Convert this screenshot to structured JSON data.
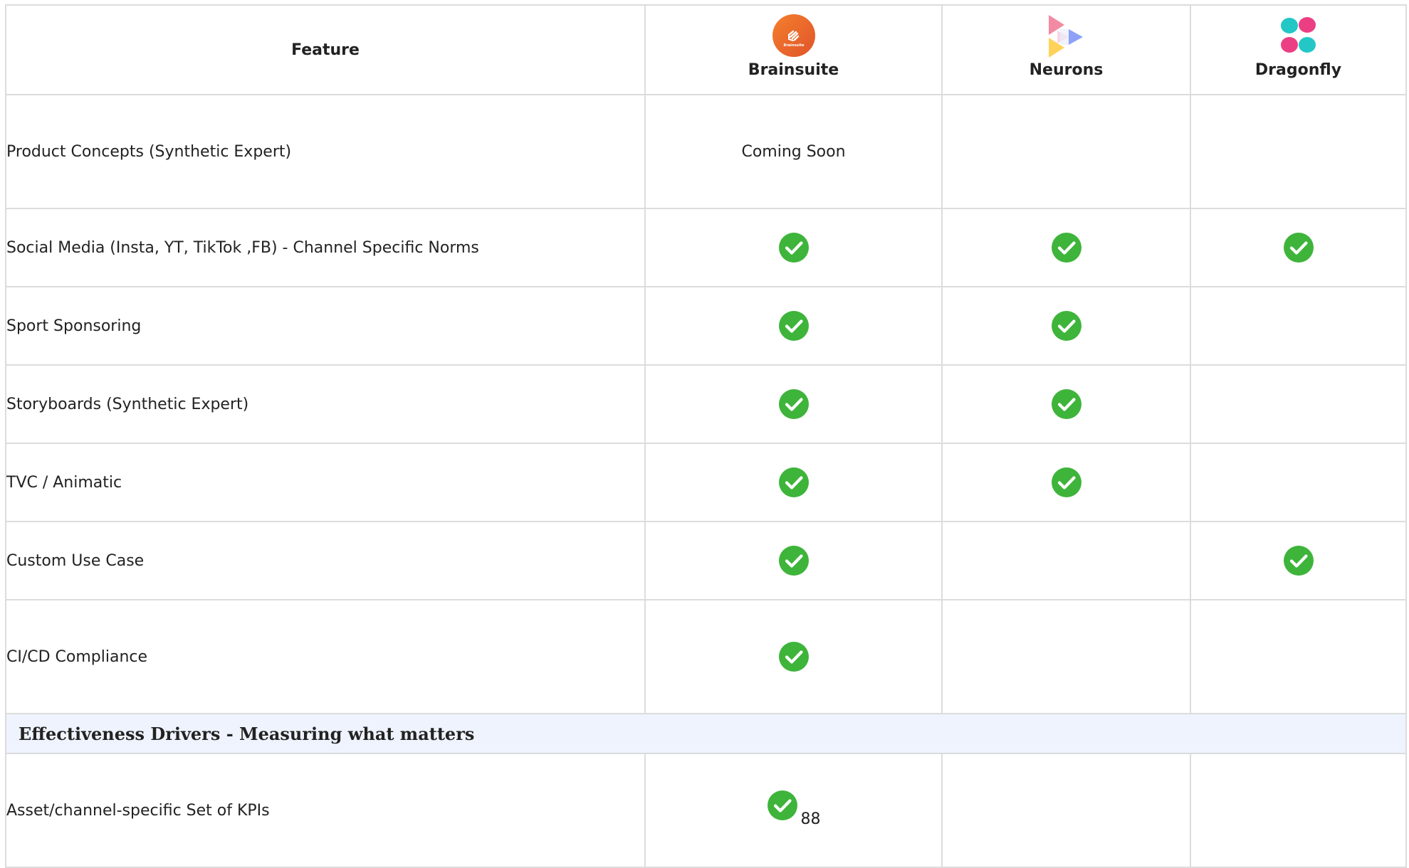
{
  "header": {
    "feature_label": "Feature",
    "vendors": [
      {
        "name": "Brainsuite",
        "logo_icon": "brainsuite-logo-icon",
        "logo_text": "Brainsuite"
      },
      {
        "name": "Neurons",
        "logo_icon": "neurons-logo-icon"
      },
      {
        "name": "Dragonfly",
        "logo_icon": "dragonfly-logo-icon"
      }
    ]
  },
  "rows": [
    {
      "feature": "Product Concepts (Synthetic Expert)",
      "brainsuite_text": "Coming Soon",
      "brainsuite": false,
      "neurons": false,
      "dragonfly": false
    },
    {
      "feature": "Social Media (Insta, YT, TikTok ,FB) - Channel Specific Norms",
      "brainsuite": true,
      "neurons": true,
      "dragonfly": true
    },
    {
      "feature": "Sport Sponsoring",
      "brainsuite": true,
      "neurons": true,
      "dragonfly": false
    },
    {
      "feature": "Storyboards (Synthetic Expert)",
      "brainsuite": true,
      "neurons": true,
      "dragonfly": false
    },
    {
      "feature": "TVC / Animatic",
      "brainsuite": true,
      "neurons": true,
      "dragonfly": false
    },
    {
      "feature": "Custom Use Case",
      "brainsuite": true,
      "neurons": false,
      "dragonfly": true
    },
    {
      "feature": "CI/CD Compliance",
      "brainsuite": true,
      "neurons": false,
      "dragonfly": false
    }
  ],
  "section": {
    "title": "Effectiveness Drivers - Measuring what matters"
  },
  "section_rows": [
    {
      "feature": "Asset/channel-specific Set of KPIs",
      "brainsuite": true,
      "brainsuite_value": "88",
      "neurons": false,
      "dragonfly": false
    }
  ],
  "colors": {
    "check": "#3eb43a",
    "border": "#dcdcdc",
    "section_bg": "#eef3fd",
    "brainsuite_logo": "#ee6a2b"
  },
  "icons": {
    "check": "check-circle-icon"
  }
}
